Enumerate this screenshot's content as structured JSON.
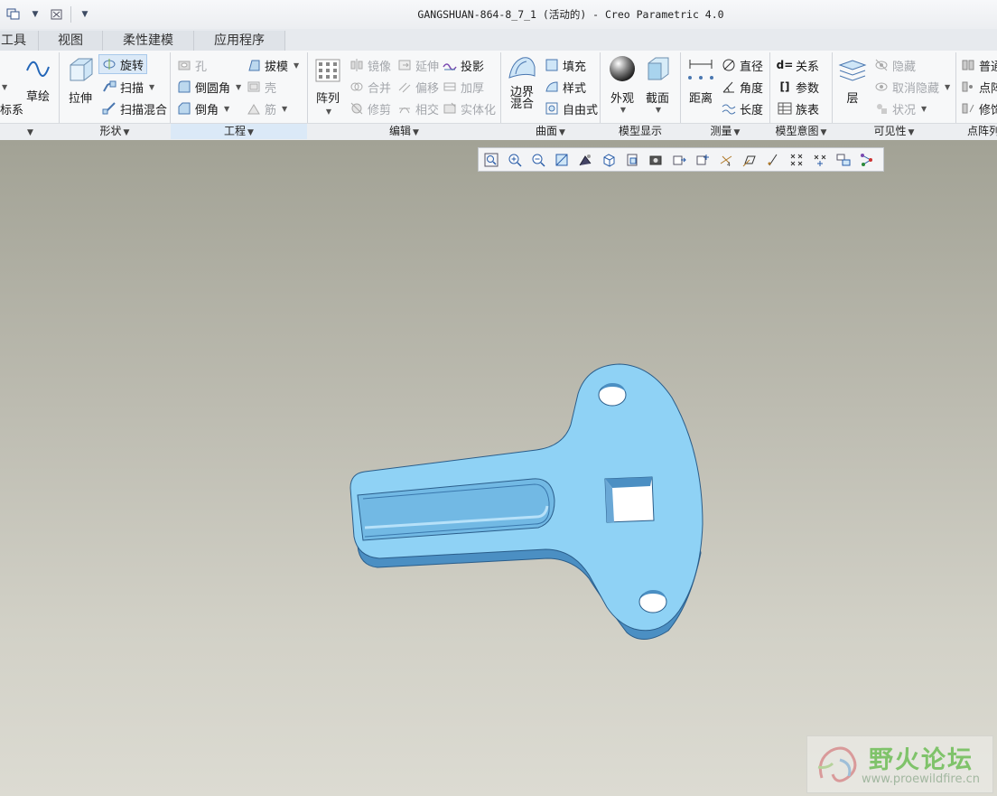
{
  "window": {
    "title": "GANGSHUAN-864-8_7_1 (活动的) - Creo Parametric 4.0"
  },
  "tabs": [
    "工具",
    "视图",
    "柔性建模",
    "应用程序"
  ],
  "ribbon": {
    "left_partial": {
      "label_top": "",
      "label_bottom": "标系"
    },
    "sketch": "草绘",
    "shape": {
      "extrude": "拉伸",
      "revolve": "旋转",
      "sweep": "扫描",
      "swept_blend": "扫描混合"
    },
    "engineering": {
      "hole": "孔",
      "round": "倒圆角",
      "chamfer": "倒角",
      "draft": "拔模",
      "shell": "壳",
      "rib": "筋"
    },
    "edit": {
      "pattern": "阵列",
      "mirror": "镜像",
      "merge": "合并",
      "trim": "修剪",
      "extend": "延伸",
      "offset": "偏移",
      "intersect": "相交",
      "project": "投影",
      "thicken": "加厚",
      "solidify": "实体化"
    },
    "surfaces": {
      "boundary_blend_1": "边界",
      "boundary_blend_2": "混合",
      "fill": "填充",
      "style": "样式",
      "freestyle": "自由式"
    },
    "model_display": {
      "appearance": "外观",
      "section": "截面"
    },
    "measure": {
      "distance": "距离",
      "diameter": "直径",
      "angle": "角度",
      "length": "长度"
    },
    "model_intent": {
      "relations": "关系",
      "parameters": "参数",
      "family_table": "族表"
    },
    "visibility": {
      "layer": "层",
      "hide": "隐藏",
      "unhide": "取消隐藏",
      "status": "状况"
    },
    "point_pattern": {
      "normal": "普通",
      "point": "点阵",
      "modify": "修饰"
    }
  },
  "groups": {
    "left": "",
    "shape": "形状",
    "engineering": "工程",
    "edit": "编辑",
    "surfaces": "曲面",
    "model_display": "模型显示",
    "measure": "测量",
    "model_intent": "模型意图",
    "visibility": "可见性",
    "point_pattern": "点阵列"
  },
  "watermark": {
    "title": "野火论坛",
    "url": "www.proewildfire.cn"
  },
  "colors": {
    "part_fill": "#8fd2f5",
    "part_shade": "#4b8fc3",
    "accent": "#dbe9f7"
  }
}
